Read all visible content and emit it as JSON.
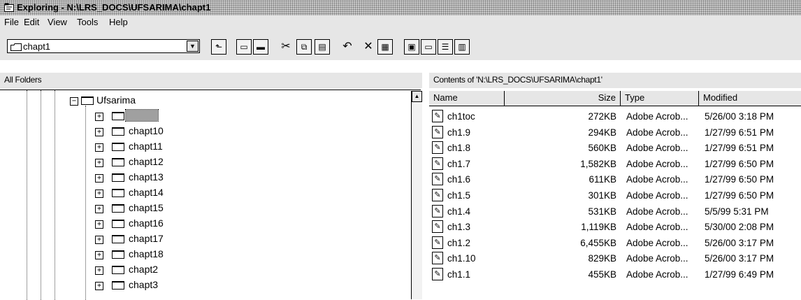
{
  "window": {
    "title": "Exploring - N:\\LRS_DOCS\\UFSARIMA\\chapt1",
    "title_icon": "explorer-icon"
  },
  "menu": [
    "File",
    "Edit",
    "View",
    "Tools",
    "Help"
  ],
  "address": {
    "value": "chapt1"
  },
  "toolbar_icons": [
    "up-folder-icon",
    "map-drive-icon",
    "disconnect-drive-icon",
    "cut-icon",
    "copy-icon",
    "paste-icon",
    "undo-icon",
    "delete-icon",
    "properties-icon",
    "large-icons-view-icon",
    "small-icons-view-icon",
    "list-view-icon",
    "details-view-icon"
  ],
  "left_pane": {
    "header": "All Folders",
    "parent": "Ufsarima",
    "selected": "chapt1",
    "folders": [
      "chapt10",
      "chapt11",
      "chapt12",
      "chapt13",
      "chapt14",
      "chapt15",
      "chapt16",
      "chapt17",
      "chapt18",
      "chapt2",
      "chapt3"
    ]
  },
  "right_pane": {
    "header": "Contents of 'N:\\LRS_DOCS\\UFSARIMA\\chapt1'",
    "columns": [
      "Name",
      "Size",
      "Type",
      "Modified"
    ],
    "files": [
      {
        "name": "ch1toc",
        "size": "272KB",
        "type": "Adobe Acrob...",
        "modified": "5/26/00 3:18 PM"
      },
      {
        "name": "ch1.9",
        "size": "294KB",
        "type": "Adobe Acrob...",
        "modified": "1/27/99 6:51 PM"
      },
      {
        "name": "ch1.8",
        "size": "560KB",
        "type": "Adobe Acrob...",
        "modified": "1/27/99 6:51 PM"
      },
      {
        "name": "ch1.7",
        "size": "1,582KB",
        "type": "Adobe Acrob...",
        "modified": "1/27/99 6:50 PM"
      },
      {
        "name": "ch1.6",
        "size": "611KB",
        "type": "Adobe Acrob...",
        "modified": "1/27/99 6:50 PM"
      },
      {
        "name": "ch1.5",
        "size": "301KB",
        "type": "Adobe Acrob...",
        "modified": "1/27/99 6:50 PM"
      },
      {
        "name": "ch1.4",
        "size": "531KB",
        "type": "Adobe Acrob...",
        "modified": "5/5/99 5:31 PM"
      },
      {
        "name": "ch1.3",
        "size": "1,119KB",
        "type": "Adobe Acrob...",
        "modified": "5/30/00 2:08 PM"
      },
      {
        "name": "ch1.2",
        "size": "6,455KB",
        "type": "Adobe Acrob...",
        "modified": "5/26/00 3:17 PM"
      },
      {
        "name": "ch1.10",
        "size": "829KB",
        "type": "Adobe Acrob...",
        "modified": "5/26/00 3:17 PM"
      },
      {
        "name": "ch1.1",
        "size": "455KB",
        "type": "Adobe Acrob...",
        "modified": "1/27/99 6:49 PM"
      }
    ]
  }
}
